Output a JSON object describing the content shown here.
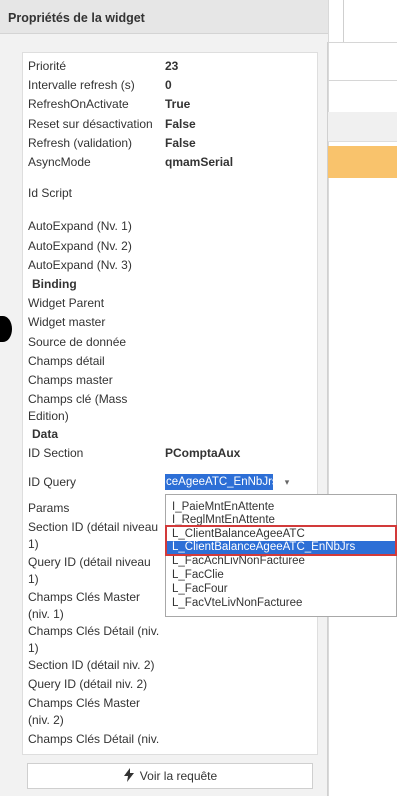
{
  "panel": {
    "title": "Propriétés de la widget"
  },
  "properties": [
    {
      "label": "Priorité",
      "value": "23"
    },
    {
      "label": "Intervalle refresh (s)",
      "value": "0"
    },
    {
      "label": "RefreshOnActivate",
      "value": "True"
    },
    {
      "label": "Reset sur désactivation",
      "value": "False"
    },
    {
      "label": "Refresh (validation)",
      "value": "False"
    },
    {
      "label": "AsyncMode",
      "value": "qmamSerial"
    },
    {
      "label": "Id Script",
      "value": ""
    },
    {
      "label": "AutoExpand (Nv. 1)",
      "value": ""
    },
    {
      "label": "AutoExpand (Nv. 2)",
      "value": ""
    },
    {
      "label": "AutoExpand (Nv. 3)",
      "value": ""
    }
  ],
  "binding_section": "Binding",
  "binding_props": [
    {
      "label": "Widget Parent"
    },
    {
      "label": "Widget master"
    },
    {
      "label": "Source de donnée"
    },
    {
      "label": "Champs détail"
    },
    {
      "label": "Champs master"
    },
    {
      "label": "Champs clé (Mass Edition)"
    }
  ],
  "data_section": "Data",
  "id_section": {
    "label": "ID Section",
    "value": "PComptaAux"
  },
  "id_query": {
    "label": "ID Query",
    "combo_text": "ceAgeeATC_EnNbJrs",
    "arrow": "▾"
  },
  "dropdown": {
    "options": [
      "I_PaieMntEnAttente",
      "I_ReglMntEnAttente",
      "L_ClientBalanceAgeeATC",
      "L_ClientBalanceAgeeATC_EnNbJrs",
      "L_FacAchLivNonFacturee",
      "L_FacClie",
      "L_FacFour",
      "L_FacVteLivNonFacturee"
    ],
    "selected_index": 3
  },
  "more_props": [
    {
      "label": "Params"
    },
    {
      "label": "Section ID (détail niveau 1)"
    },
    {
      "label": "Query ID (détail niveau 1)"
    },
    {
      "label": "Champs Clés Master (niv. 1)"
    },
    {
      "label": "Champs Clés Détail (niv. 1)"
    },
    {
      "label": "Section ID (détail niv. 2)"
    },
    {
      "label": "Query ID (détail niv. 2)"
    },
    {
      "label": "Champs Clés Master (niv. 2)"
    },
    {
      "label": "Champs Clés Détail (niv."
    }
  ],
  "button": {
    "icon": "lightning-bolt-icon",
    "label": "Voir la requête"
  },
  "colors": {
    "selection": "#2d6fd6",
    "highlight_border": "#d23a3a",
    "background_band": "#f9c36c"
  }
}
